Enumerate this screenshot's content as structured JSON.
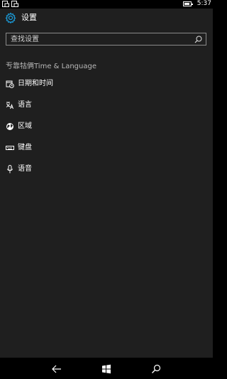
{
  "status_bar": {
    "time": "5:37",
    "icons": [
      "notification-icon",
      "notification-icon",
      "battery-icon"
    ]
  },
  "header": {
    "title": "设置",
    "icon": "gear-icon",
    "accent": "#1aa0e0"
  },
  "search": {
    "placeholder": "查找设置"
  },
  "section": {
    "title": "亐靠牯俩Time & Language"
  },
  "items": [
    {
      "label": "日期和时间",
      "icon": "calendar-clock-icon"
    },
    {
      "label": "语言",
      "icon": "language-icon"
    },
    {
      "label": "区域",
      "icon": "globe-icon"
    },
    {
      "label": "键盘",
      "icon": "keyboard-icon"
    },
    {
      "label": "语音",
      "icon": "microphone-icon"
    }
  ],
  "navigation": {
    "buttons": [
      "back-icon",
      "windows-start-icon",
      "search-icon"
    ]
  }
}
